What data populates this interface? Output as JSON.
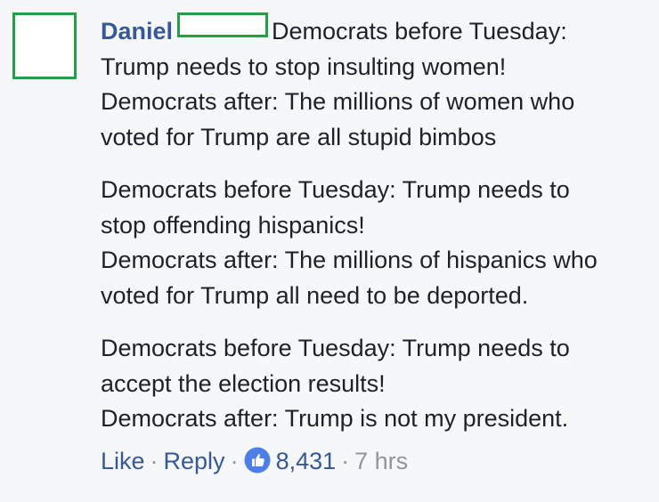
{
  "comment": {
    "author": "Daniel",
    "paragraphs": [
      [
        "Democrats before Tuesday:",
        "Trump needs to stop insulting women!",
        "Democrats after: The millions of women who",
        "voted for Trump are all stupid bimbos"
      ],
      [
        "Democrats before Tuesday: Trump needs to",
        "stop offending hispanics!",
        "Democrats after: The millions of hispanics who",
        "voted for Trump all need to be deported."
      ],
      [
        "Democrats before Tuesday: Trump needs to",
        "accept the election results!",
        "Democrats after: Trump is not my president."
      ]
    ]
  },
  "actions": {
    "like_label": "Like",
    "separator": "·",
    "reply_label": "Reply",
    "like_count": "8,431",
    "time": "7 hrs"
  },
  "colors": {
    "link": "#365899",
    "meta": "#90949c",
    "redaction_border": "#23a046",
    "background": "#f6f7f9"
  },
  "icons": [
    "like-thumbs-up-icon"
  ]
}
